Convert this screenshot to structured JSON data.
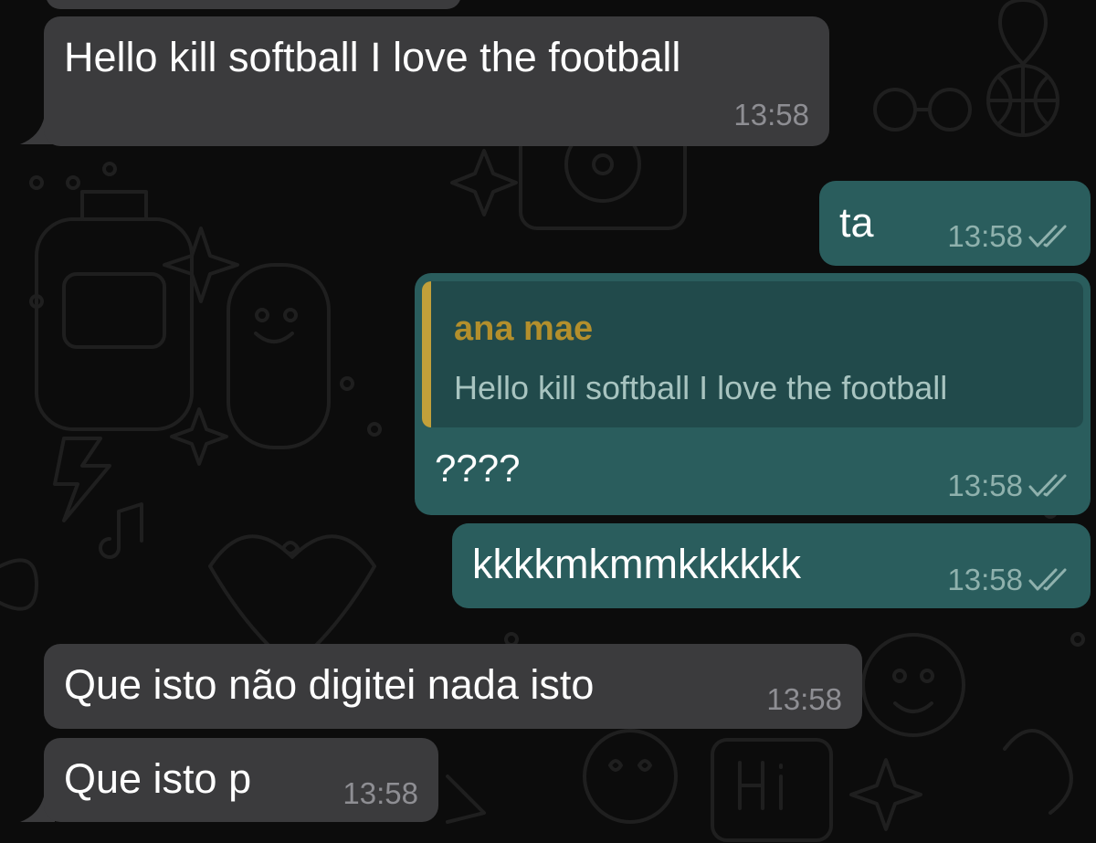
{
  "chat": {
    "messages": [
      {
        "direction": "incoming",
        "text": "Hello kill softball I love the football",
        "time": "13:58"
      },
      {
        "direction": "outgoing",
        "text": "ta",
        "time": "13:58",
        "status": "read"
      },
      {
        "direction": "outgoing",
        "text": "????",
        "time": "13:58",
        "status": "read",
        "reply_to": {
          "author": "ana mae",
          "text": "Hello kill softball I love the football"
        }
      },
      {
        "direction": "outgoing",
        "text": "kkkkmkmmkkkkkk",
        "time": "13:58",
        "status": "read"
      },
      {
        "direction": "incoming",
        "text": "Que isto não digitei nada isto",
        "time": "13:58"
      },
      {
        "direction": "incoming",
        "text": "Que isto p",
        "time": "13:58"
      }
    ]
  },
  "colors": {
    "background": "#0c0c0c",
    "incoming_bubble": "#3b3b3d",
    "outgoing_bubble": "#2a5d5d",
    "quote_background": "#214a4b",
    "quote_accent": "#c2a03a",
    "quote_author": "#b38f2c"
  },
  "icons": {
    "read_receipt": "double-check-icon"
  }
}
